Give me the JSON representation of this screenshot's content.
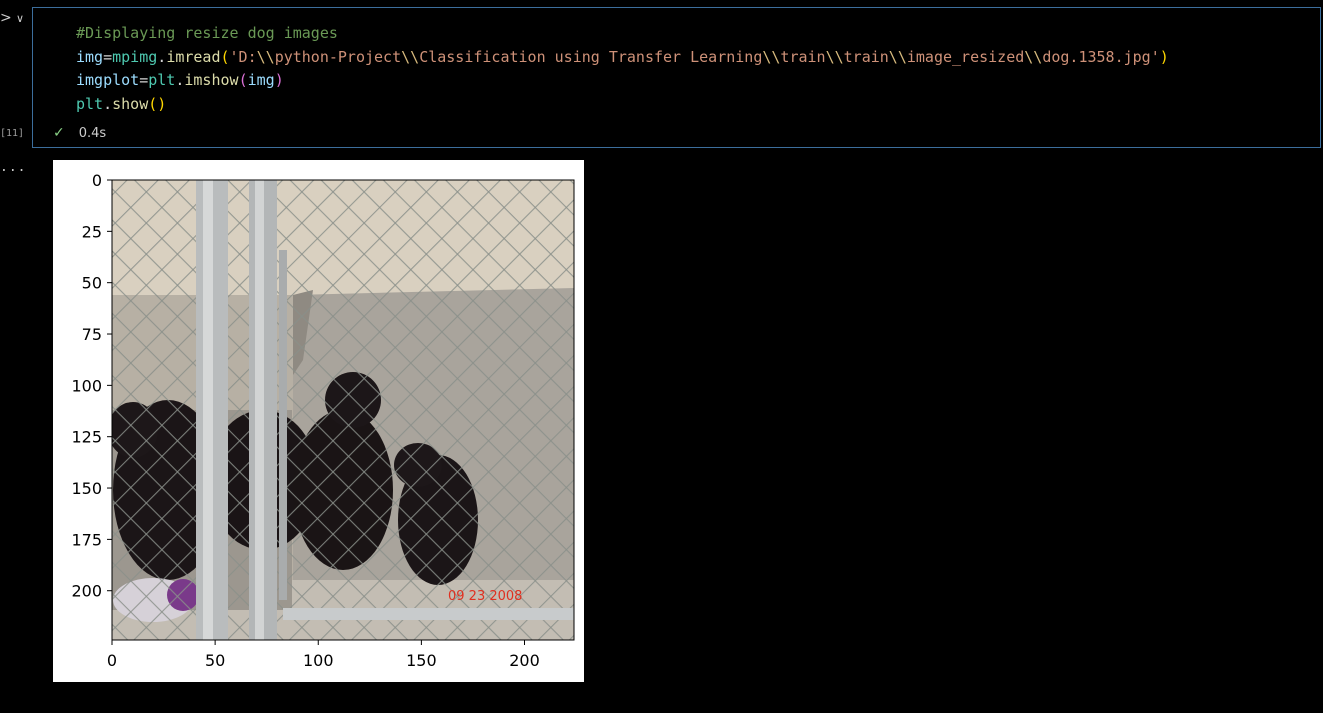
{
  "cell": {
    "execution_count": "[11]",
    "code": {
      "comment": "#Displaying resize dog images",
      "line2": {
        "var": "img",
        "eq": "=",
        "mod": "mpimg",
        "dot": ".",
        "fn": "imread",
        "open": "(",
        "str_parts": [
          "'D:",
          "\\\\",
          "python-Project",
          "\\\\",
          "Classification using Transfer Learning",
          "\\\\",
          "train",
          "\\\\",
          "train",
          "\\\\",
          "image_resized",
          "\\\\",
          "dog.1358.jpg'"
        ],
        "close": ")"
      },
      "line3": {
        "var": "imgplot",
        "eq": "=",
        "mod": "plt",
        "dot": ".",
        "fn": "imshow",
        "open": "(",
        "arg": "img",
        "close": ")"
      },
      "line4": {
        "mod": "plt",
        "dot": ".",
        "fn": "show",
        "parens": "()"
      }
    },
    "status": {
      "check_icon": "check-icon",
      "duration": "0.4s"
    }
  },
  "gutter": {
    "toggle_icon": "run-caret-icon",
    "toggle_glyph": ">",
    "chevron_icon": "chevron-down-icon",
    "chevron_glyph": "∨",
    "output_ellipsis": "..."
  },
  "output": {
    "image_description": "resized dog image",
    "chart_data": {
      "type": "image",
      "x_ticks": [
        "0",
        "50",
        "100",
        "150",
        "200"
      ],
      "y_ticks": [
        "0",
        "25",
        "50",
        "75",
        "100",
        "125",
        "150",
        "175",
        "200"
      ],
      "xlim": [
        0,
        224
      ],
      "ylim": [
        224,
        0
      ],
      "stamp_text": "09 23 2008"
    }
  }
}
